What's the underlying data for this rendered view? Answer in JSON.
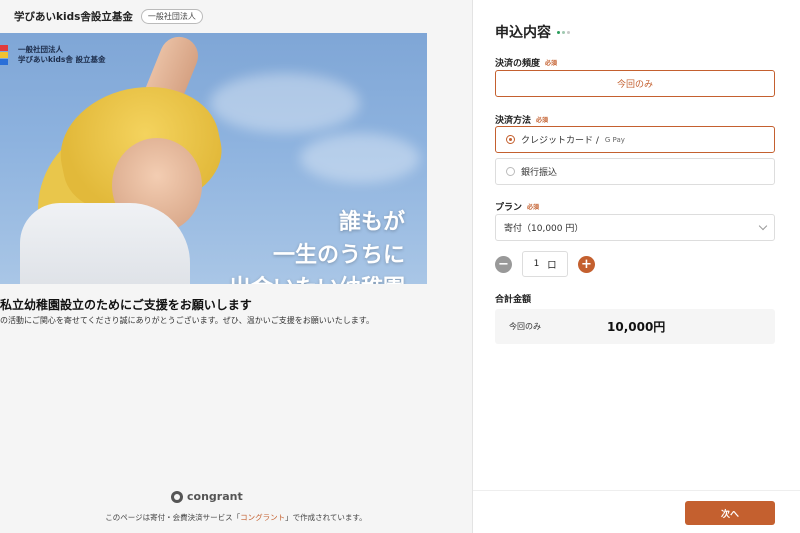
{
  "organization": {
    "name": "学びあいkids舎設立基金",
    "badge": "一般社団法人"
  },
  "hero": {
    "logo_line1": "一般社団法人",
    "logo_line2": "学びあいkids舎 設立基金",
    "headline_lines": [
      "誰もが",
      "一生のうちに",
      "出会いたい幼稚園"
    ],
    "logo_colors": [
      "#e23b3b",
      "#f1c232",
      "#2a6fd8"
    ]
  },
  "campaign": {
    "title": "私立幼稚園設立のためにご支援をお願いします",
    "description": "の活動にご関心を寄せてくださり誠にありがとうございます。ぜひ、温かいご支援をお願いいたします。"
  },
  "footer": {
    "brand": "congrant",
    "note_prefix": "このページは寄付・会費決済サービス「",
    "note_link": "コングラント",
    "note_suffix": "」で作成されています。"
  },
  "form": {
    "title": "申込内容",
    "progress_dot_colors": [
      "#2a9d5c",
      "#9fc9b0",
      "#c9c9c9"
    ],
    "frequency": {
      "label": "決済の頻度",
      "required": "必須",
      "selected": "今回のみ"
    },
    "payment_method": {
      "label": "決済方法",
      "required": "必須",
      "options": [
        {
          "label": "クレジットカード /",
          "extra": "G Pay",
          "selected": true
        },
        {
          "label": "銀行振込",
          "extra": "",
          "selected": false
        }
      ]
    },
    "plan": {
      "label": "プラン",
      "required": "必須",
      "selected": "寄付（10,000 円）"
    },
    "quantity": {
      "value": "1",
      "unit": "口",
      "minus": "−",
      "plus": "+"
    },
    "total": {
      "label": "合計金額",
      "period": "今回のみ",
      "amount": "10,000円"
    },
    "next_label": "次へ",
    "accent_color": "#c4602f"
  }
}
